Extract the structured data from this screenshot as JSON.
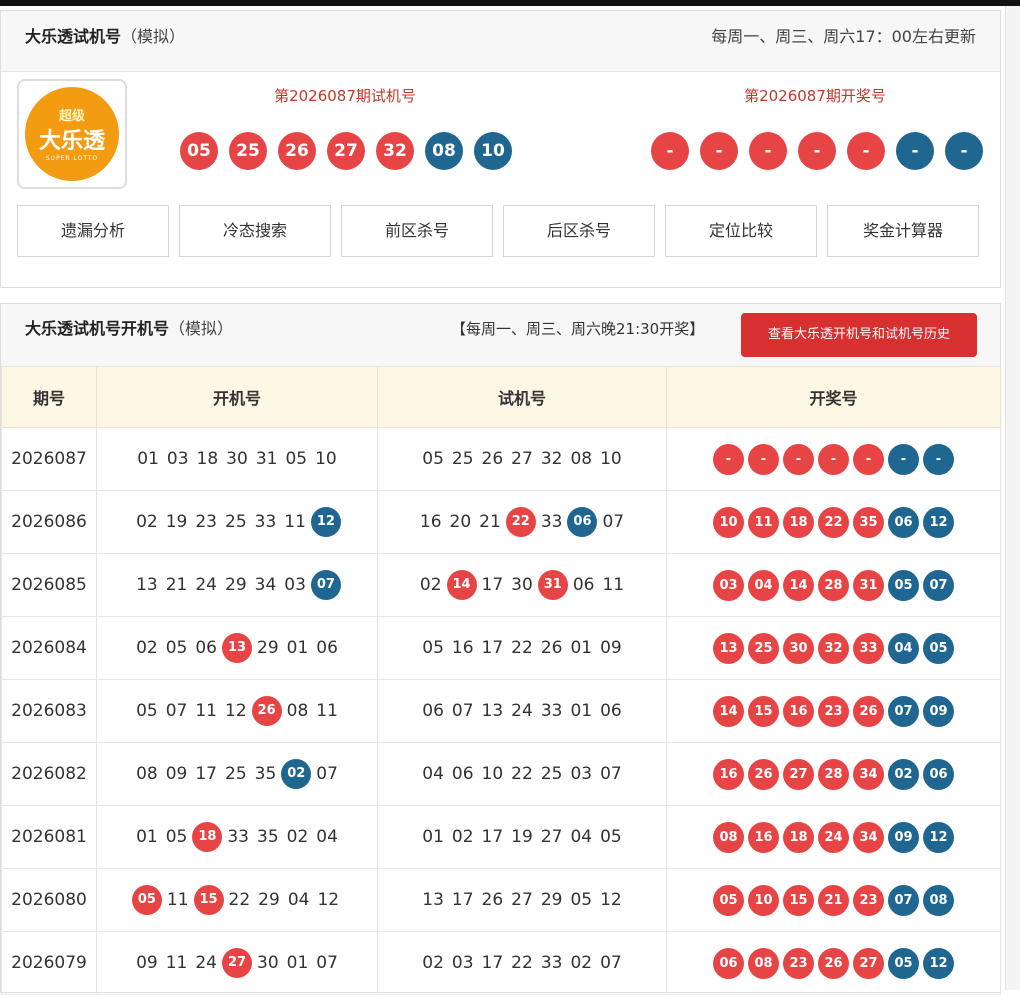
{
  "panel1": {
    "title": "大乐透试机号",
    "title_suffix": "（模拟）",
    "schedule": "每周一、周三、周六17：00左右更新",
    "logo": {
      "small": "超级",
      "main": "大乐透",
      "tiny": "SUPER LOTTO"
    },
    "trial_label": "第2026087期试机号",
    "draw_label": "第2026087期开奖号",
    "trial_balls": [
      {
        "v": "05",
        "c": "red"
      },
      {
        "v": "25",
        "c": "red"
      },
      {
        "v": "26",
        "c": "red"
      },
      {
        "v": "27",
        "c": "red"
      },
      {
        "v": "32",
        "c": "red"
      },
      {
        "v": "08",
        "c": "blue"
      },
      {
        "v": "10",
        "c": "blue"
      }
    ],
    "draw_balls": [
      {
        "v": "-",
        "c": "red"
      },
      {
        "v": "-",
        "c": "red"
      },
      {
        "v": "-",
        "c": "red"
      },
      {
        "v": "-",
        "c": "red"
      },
      {
        "v": "-",
        "c": "red"
      },
      {
        "v": "-",
        "c": "blue"
      },
      {
        "v": "-",
        "c": "blue"
      }
    ],
    "tools": [
      "遗漏分析",
      "冷态搜索",
      "前区杀号",
      "后区杀号",
      "定位比较",
      "奖金计算器"
    ]
  },
  "panel2": {
    "title": "大乐透试机号开机号",
    "title_suffix": "（模拟）",
    "schedule": "【每周一、周三、周六晚21:30开奖】",
    "history_button": "查看大乐透开机号和试机号历史",
    "columns": [
      "期号",
      "开机号",
      "试机号",
      "开奖号"
    ],
    "rows": [
      {
        "issue": "2026087",
        "open": [
          {
            "v": "01"
          },
          {
            "v": "03"
          },
          {
            "v": "18"
          },
          {
            "v": "30"
          },
          {
            "v": "31"
          },
          {
            "v": "05"
          },
          {
            "v": "10"
          }
        ],
        "trial": [
          {
            "v": "05"
          },
          {
            "v": "25"
          },
          {
            "v": "26"
          },
          {
            "v": "27"
          },
          {
            "v": "32"
          },
          {
            "v": "08"
          },
          {
            "v": "10"
          }
        ],
        "draw": [
          {
            "v": "-",
            "c": "red"
          },
          {
            "v": "-",
            "c": "red"
          },
          {
            "v": "-",
            "c": "red"
          },
          {
            "v": "-",
            "c": "red"
          },
          {
            "v": "-",
            "c": "red"
          },
          {
            "v": "-",
            "c": "blue"
          },
          {
            "v": "-",
            "c": "blue"
          }
        ]
      },
      {
        "issue": "2026086",
        "open": [
          {
            "v": "02"
          },
          {
            "v": "19"
          },
          {
            "v": "23"
          },
          {
            "v": "25"
          },
          {
            "v": "33"
          },
          {
            "v": "11"
          },
          {
            "v": "12",
            "c": "blue"
          }
        ],
        "trial": [
          {
            "v": "16"
          },
          {
            "v": "20"
          },
          {
            "v": "21"
          },
          {
            "v": "22",
            "c": "red"
          },
          {
            "v": "33"
          },
          {
            "v": "06",
            "c": "blue"
          },
          {
            "v": "07"
          }
        ],
        "draw": [
          {
            "v": "10",
            "c": "red"
          },
          {
            "v": "11",
            "c": "red"
          },
          {
            "v": "18",
            "c": "red"
          },
          {
            "v": "22",
            "c": "red"
          },
          {
            "v": "35",
            "c": "red"
          },
          {
            "v": "06",
            "c": "blue"
          },
          {
            "v": "12",
            "c": "blue"
          }
        ]
      },
      {
        "issue": "2026085",
        "open": [
          {
            "v": "13"
          },
          {
            "v": "21"
          },
          {
            "v": "24"
          },
          {
            "v": "29"
          },
          {
            "v": "34"
          },
          {
            "v": "03"
          },
          {
            "v": "07",
            "c": "blue"
          }
        ],
        "trial": [
          {
            "v": "02"
          },
          {
            "v": "14",
            "c": "red"
          },
          {
            "v": "17"
          },
          {
            "v": "30"
          },
          {
            "v": "31",
            "c": "red"
          },
          {
            "v": "06"
          },
          {
            "v": "11"
          }
        ],
        "draw": [
          {
            "v": "03",
            "c": "red"
          },
          {
            "v": "04",
            "c": "red"
          },
          {
            "v": "14",
            "c": "red"
          },
          {
            "v": "28",
            "c": "red"
          },
          {
            "v": "31",
            "c": "red"
          },
          {
            "v": "05",
            "c": "blue"
          },
          {
            "v": "07",
            "c": "blue"
          }
        ]
      },
      {
        "issue": "2026084",
        "open": [
          {
            "v": "02"
          },
          {
            "v": "05"
          },
          {
            "v": "06"
          },
          {
            "v": "13",
            "c": "red"
          },
          {
            "v": "29"
          },
          {
            "v": "01"
          },
          {
            "v": "06"
          }
        ],
        "trial": [
          {
            "v": "05"
          },
          {
            "v": "16"
          },
          {
            "v": "17"
          },
          {
            "v": "22"
          },
          {
            "v": "26"
          },
          {
            "v": "01"
          },
          {
            "v": "09"
          }
        ],
        "draw": [
          {
            "v": "13",
            "c": "red"
          },
          {
            "v": "25",
            "c": "red"
          },
          {
            "v": "30",
            "c": "red"
          },
          {
            "v": "32",
            "c": "red"
          },
          {
            "v": "33",
            "c": "red"
          },
          {
            "v": "04",
            "c": "blue"
          },
          {
            "v": "05",
            "c": "blue"
          }
        ]
      },
      {
        "issue": "2026083",
        "open": [
          {
            "v": "05"
          },
          {
            "v": "07"
          },
          {
            "v": "11"
          },
          {
            "v": "12"
          },
          {
            "v": "26",
            "c": "red"
          },
          {
            "v": "08"
          },
          {
            "v": "11"
          }
        ],
        "trial": [
          {
            "v": "06"
          },
          {
            "v": "07"
          },
          {
            "v": "13"
          },
          {
            "v": "24"
          },
          {
            "v": "33"
          },
          {
            "v": "01"
          },
          {
            "v": "06"
          }
        ],
        "draw": [
          {
            "v": "14",
            "c": "red"
          },
          {
            "v": "15",
            "c": "red"
          },
          {
            "v": "16",
            "c": "red"
          },
          {
            "v": "23",
            "c": "red"
          },
          {
            "v": "26",
            "c": "red"
          },
          {
            "v": "07",
            "c": "blue"
          },
          {
            "v": "09",
            "c": "blue"
          }
        ]
      },
      {
        "issue": "2026082",
        "open": [
          {
            "v": "08"
          },
          {
            "v": "09"
          },
          {
            "v": "17"
          },
          {
            "v": "25"
          },
          {
            "v": "35"
          },
          {
            "v": "02",
            "c": "blue"
          },
          {
            "v": "07"
          }
        ],
        "trial": [
          {
            "v": "04"
          },
          {
            "v": "06"
          },
          {
            "v": "10"
          },
          {
            "v": "22"
          },
          {
            "v": "25"
          },
          {
            "v": "03"
          },
          {
            "v": "07"
          }
        ],
        "draw": [
          {
            "v": "16",
            "c": "red"
          },
          {
            "v": "26",
            "c": "red"
          },
          {
            "v": "27",
            "c": "red"
          },
          {
            "v": "28",
            "c": "red"
          },
          {
            "v": "34",
            "c": "red"
          },
          {
            "v": "02",
            "c": "blue"
          },
          {
            "v": "06",
            "c": "blue"
          }
        ]
      },
      {
        "issue": "2026081",
        "open": [
          {
            "v": "01"
          },
          {
            "v": "05"
          },
          {
            "v": "18",
            "c": "red"
          },
          {
            "v": "33"
          },
          {
            "v": "35"
          },
          {
            "v": "02"
          },
          {
            "v": "04"
          }
        ],
        "trial": [
          {
            "v": "01"
          },
          {
            "v": "02"
          },
          {
            "v": "17"
          },
          {
            "v": "19"
          },
          {
            "v": "27"
          },
          {
            "v": "04"
          },
          {
            "v": "05"
          }
        ],
        "draw": [
          {
            "v": "08",
            "c": "red"
          },
          {
            "v": "16",
            "c": "red"
          },
          {
            "v": "18",
            "c": "red"
          },
          {
            "v": "24",
            "c": "red"
          },
          {
            "v": "34",
            "c": "red"
          },
          {
            "v": "09",
            "c": "blue"
          },
          {
            "v": "12",
            "c": "blue"
          }
        ]
      },
      {
        "issue": "2026080",
        "open": [
          {
            "v": "05",
            "c": "red"
          },
          {
            "v": "11"
          },
          {
            "v": "15",
            "c": "red"
          },
          {
            "v": "22"
          },
          {
            "v": "29"
          },
          {
            "v": "04"
          },
          {
            "v": "12"
          }
        ],
        "trial": [
          {
            "v": "13"
          },
          {
            "v": "17"
          },
          {
            "v": "26"
          },
          {
            "v": "27"
          },
          {
            "v": "29"
          },
          {
            "v": "05"
          },
          {
            "v": "12"
          }
        ],
        "draw": [
          {
            "v": "05",
            "c": "red"
          },
          {
            "v": "10",
            "c": "red"
          },
          {
            "v": "15",
            "c": "red"
          },
          {
            "v": "21",
            "c": "red"
          },
          {
            "v": "23",
            "c": "red"
          },
          {
            "v": "07",
            "c": "blue"
          },
          {
            "v": "08",
            "c": "blue"
          }
        ]
      },
      {
        "issue": "2026079",
        "open": [
          {
            "v": "09"
          },
          {
            "v": "11"
          },
          {
            "v": "24"
          },
          {
            "v": "27",
            "c": "red"
          },
          {
            "v": "30"
          },
          {
            "v": "01"
          },
          {
            "v": "07"
          }
        ],
        "trial": [
          {
            "v": "02"
          },
          {
            "v": "03"
          },
          {
            "v": "17"
          },
          {
            "v": "22"
          },
          {
            "v": "33"
          },
          {
            "v": "02"
          },
          {
            "v": "07"
          }
        ],
        "draw": [
          {
            "v": "06",
            "c": "red"
          },
          {
            "v": "08",
            "c": "red"
          },
          {
            "v": "23",
            "c": "red"
          },
          {
            "v": "26",
            "c": "red"
          },
          {
            "v": "27",
            "c": "red"
          },
          {
            "v": "05",
            "c": "blue"
          },
          {
            "v": "12",
            "c": "blue"
          }
        ]
      }
    ]
  },
  "colors": {
    "red_ball": "#e74545",
    "blue_ball": "#1f6690",
    "label_red": "#c0392b",
    "button_red": "#d63031"
  }
}
